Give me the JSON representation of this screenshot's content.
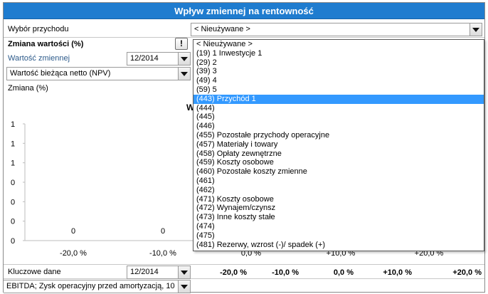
{
  "title": "Wpływ zmiennej na rentowność",
  "revenue_select": {
    "label": "Wybór przychodu",
    "value": "< Nieużywane >"
  },
  "variable_change": {
    "label": "Zmiana wartości (%)",
    "info_label": "!"
  },
  "variable_value": {
    "label": "Wartość zmiennej",
    "period": "12/2014"
  },
  "metric_select": {
    "value": "Wartość bieżąca netto (NPV)"
  },
  "change_label": "Zmiana (%)",
  "chart_data": {
    "type": "bar",
    "title": "W",
    "categories": [
      "-20,0 %",
      "-10,0 %",
      "0,0 %",
      "+10,0 %",
      "+20,0 %"
    ],
    "values": [
      0,
      0,
      0,
      0,
      0
    ],
    "y_tick_labels": [
      "1",
      "1",
      "1",
      "0",
      "0",
      "0",
      "0"
    ],
    "grid": false
  },
  "key_data": {
    "label": "Kluczowe dane",
    "period": "12/2014",
    "columns": [
      "-20,0 %",
      "-10,0 %",
      "0,0 %",
      "+10,0 %",
      "+20,0 %"
    ]
  },
  "ebitda_select": {
    "value": "EBITDA; Zysk operacyjny przed amortyzacją, 10"
  },
  "dropdown": {
    "items": [
      "< Nieużywane >",
      "(19) 1 Inwestycje 1",
      "(29) 2",
      "(39) 3",
      "(49) 4",
      "(59) 5",
      "(443) Przychód 1",
      "(444)",
      "(445)",
      "(446)",
      "(455) Pozostałe przychody operacyjne",
      "(457) Materiały i towary",
      "(458) Opłaty zewnętrzne",
      "(459) Koszty osobowe",
      "(460) Pozostałe koszty zmienne",
      "(461)",
      "(462)",
      "(471) Koszty osobowe",
      "(472) Wynajem/czynsz",
      "(473) Inne koszty stałe",
      "(474)",
      "(475)",
      "(481) Rezerwy, wzrost (-)/ spadek (+)"
    ],
    "selected_index": 6
  },
  "colors": {
    "title_bar": "#1f7ccf",
    "selection": "#3399ff"
  }
}
